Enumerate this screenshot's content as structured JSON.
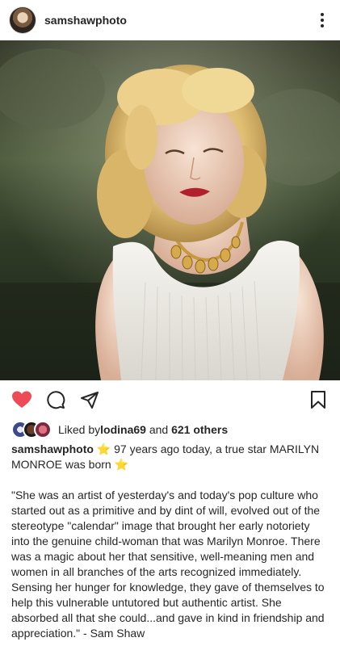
{
  "header": {
    "username": "samshawphoto",
    "more_icon": "more-vertical-icon"
  },
  "photo": {
    "description_icon": "post-photo"
  },
  "actions": {
    "liked": true,
    "like_color": "#ed4956",
    "icons": [
      "heart-icon",
      "comment-icon",
      "share-icon",
      "bookmark-icon"
    ]
  },
  "likes": {
    "prefix": "Liked by ",
    "user": "lodina69",
    "middle": " and ",
    "others": "621 others"
  },
  "caption": {
    "username": "samshawphoto",
    "star": "⭐",
    "line1": " 97 years ago today, a true star MARILYN MONROE was born ",
    "quote": "\"She was an artist of yesterday's and today's pop culture who started out as a primitive and by dint of will, evolved out of the stereotype \"calendar\" image that brought her early notoriety into the genuine child-woman that was Marilyn Monroe. There was a magic about her that sensitive, well-meaning men and women in all branches of the arts recognized immediately. Sensing her hunger for knowledge, they gave of themselves to help this vulnerable untutored but authentic artist. She absorbed all that she could...and gave in kind in friendship and appreciation.\" - Sam Shaw"
  },
  "colors": {
    "text": "#262626",
    "accent_red": "#ed4956",
    "star": "#f5c518"
  }
}
